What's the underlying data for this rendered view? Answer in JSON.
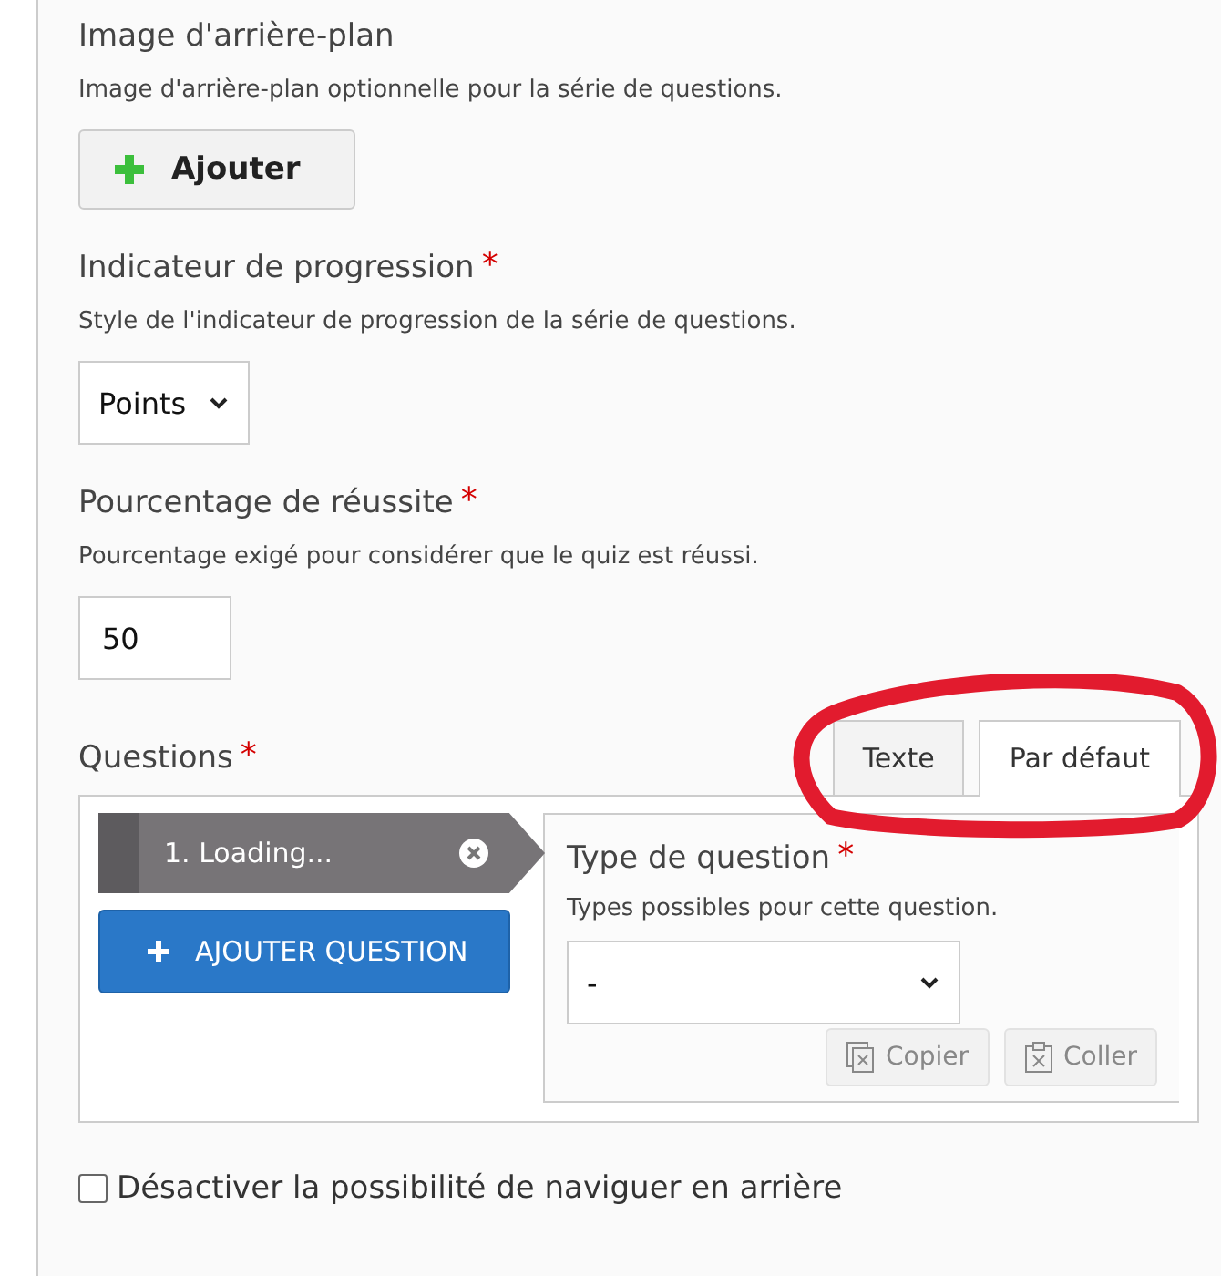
{
  "fields": [
    {
      "kind": "upload",
      "label": "Image d'arrière-plan",
      "description": "Image d'arrière-plan optionnelle pour la série de questions.",
      "button": "Ajouter"
    },
    {
      "kind": "select",
      "label": "Indicateur de progression",
      "required_mark": "*",
      "description": "Style de l'indicateur de progression de la série de questions.",
      "value": "Points"
    },
    {
      "kind": "number",
      "label": "Pourcentage de réussite",
      "required_mark": "*",
      "description": "Pourcentage exigé pour considérer que le quiz est réussi.",
      "value": "50"
    }
  ],
  "questions": {
    "label": "Questions",
    "required_mark": "*",
    "tabs": [
      {
        "label": "Texte",
        "selected": false
      },
      {
        "label": "Par défaut",
        "selected": true
      }
    ],
    "items": [
      {
        "label": "1. Loading..."
      }
    ],
    "add_button": "AJOUTER QUESTION",
    "type_field": {
      "label": "Type de question",
      "required_mark": "*",
      "description": "Types possibles pour cette question.",
      "value": "-"
    },
    "actions": [
      {
        "label": "Copier",
        "disabled": true
      },
      {
        "label": "Coller",
        "disabled": true
      }
    ]
  },
  "checkbox": {
    "label": "Désactiver la possibilité de naviguer en arrière",
    "checked": false
  }
}
